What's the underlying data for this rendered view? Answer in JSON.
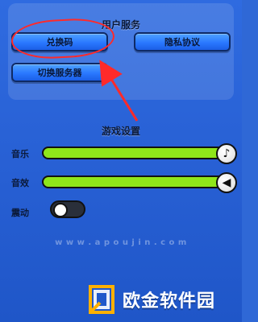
{
  "sections": {
    "user_services_title": "用户服务",
    "game_settings_title": "游戏设置"
  },
  "buttons": {
    "redeem_code": "兑换码",
    "privacy_policy": "隐私协议",
    "switch_server": "切换服务器"
  },
  "settings": {
    "music_label": "音乐",
    "sound_effects_label": "音效",
    "vibration_label": "震动",
    "music_level": 1.0,
    "sound_effects_level": 1.0,
    "vibration_on": false
  },
  "annotations": {
    "highlight_color": "#ff2a2a"
  },
  "watermark": {
    "url": "w w w . a p o u j i n . c o m",
    "brand_text": "欧金软件园"
  },
  "icons": {
    "music": "music-note-icon",
    "sfx": "speaker-icon"
  }
}
